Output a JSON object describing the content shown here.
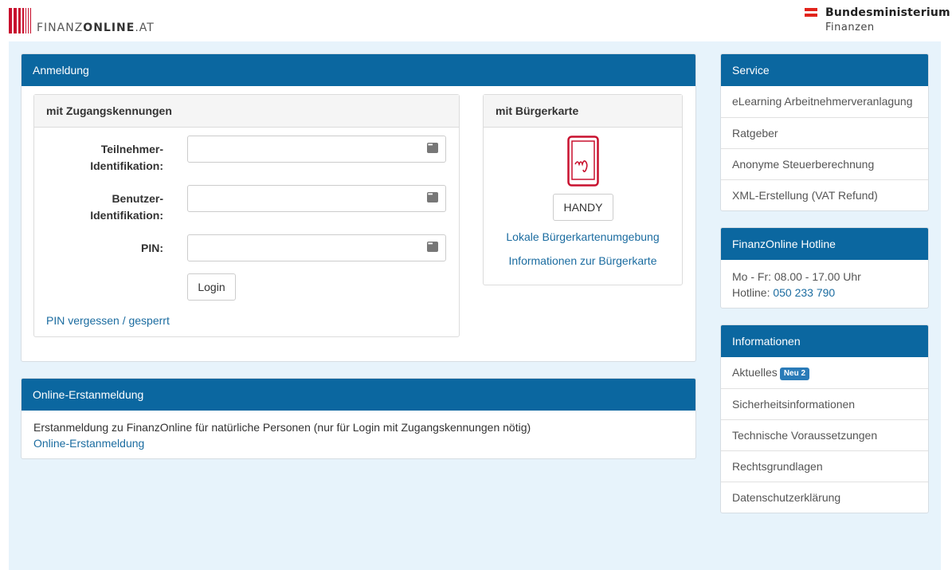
{
  "header": {
    "logo_prefix": "FINANZ",
    "logo_bold": "ONLINE",
    "logo_suffix": ".AT",
    "ministry_title": "Bundesministerium",
    "ministry_subtitle": "Finanzen"
  },
  "colors": {
    "primary": "#0b67a0",
    "background": "#e7f3fb",
    "link": "#1b6ca0",
    "logo_red": "#c8102e",
    "badge": "#2a7bb8"
  },
  "anmeldung": {
    "title": "Anmeldung",
    "credentials": {
      "title": "mit Zugangskennungen",
      "participant_label_1": "Teilnehmer-",
      "participant_label_2": "Identifikation:",
      "user_label_1": "Benutzer-",
      "user_label_2": "Identifikation:",
      "pin_label": "PIN:",
      "participant_value": "",
      "user_value": "",
      "pin_value": "",
      "login_button": "Login",
      "forgot_link": "PIN vergessen / gesperrt"
    },
    "citizen_card": {
      "title": "mit Bürgerkarte",
      "phone_icon": "mobile-signature-icon",
      "handy_button": "HANDY",
      "local_link": "Lokale Bürgerkartenumgebung",
      "info_link": "Informationen zur Bürgerkarte"
    }
  },
  "registration": {
    "title": "Online-Erstanmeldung",
    "text": "Erstanmeldung zu FinanzOnline für natürliche Personen (nur für Login mit Zugangskennungen nötig)",
    "link": "Online-Erstanmeldung"
  },
  "service": {
    "title": "Service",
    "items": [
      {
        "label": "eLearning Arbeitnehmerveranlagung"
      },
      {
        "label": "Ratgeber"
      },
      {
        "label": "Anonyme Steuerberechnung"
      },
      {
        "label": "XML-Erstellung (VAT Refund)"
      }
    ]
  },
  "hotline": {
    "title": "FinanzOnline Hotline",
    "hours": "Mo - Fr: 08.00 - 17.00 Uhr",
    "phone_label": "Hotline:",
    "phone_number": "050 233 790"
  },
  "informationen": {
    "title": "Informationen",
    "items": [
      {
        "label": "Aktuelles",
        "badge": "Neu 2"
      },
      {
        "label": "Sicherheitsinformationen"
      },
      {
        "label": "Technische Voraussetzungen"
      },
      {
        "label": "Rechtsgrundlagen"
      },
      {
        "label": "Datenschutzerklärung"
      }
    ]
  }
}
